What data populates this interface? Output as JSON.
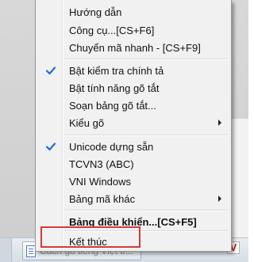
{
  "menu": {
    "items": [
      {
        "label": "Hướng dẫn",
        "checked": false,
        "submenu": false,
        "bold": false
      },
      {
        "label": "Công cụ...[CS+F6]",
        "checked": false,
        "submenu": false,
        "bold": false
      },
      {
        "label": "Chuyển mã nhanh - [CS+F9]",
        "checked": false,
        "submenu": false,
        "bold": false
      },
      {
        "label": "Bật kiểm tra chính tả",
        "checked": true,
        "submenu": false,
        "bold": false
      },
      {
        "label": "Bật tính năng gõ tắt",
        "checked": false,
        "submenu": false,
        "bold": false
      },
      {
        "label": "Soạn bảng gõ tắt...",
        "checked": false,
        "submenu": false,
        "bold": false
      },
      {
        "label": "Kiểu gõ",
        "checked": false,
        "submenu": true,
        "bold": false
      },
      {
        "label": "Unicode dựng sẵn",
        "checked": true,
        "submenu": false,
        "bold": false
      },
      {
        "label": "TCVN3 (ABC)",
        "checked": false,
        "submenu": false,
        "bold": false
      },
      {
        "label": "VNI Windows",
        "checked": false,
        "submenu": false,
        "bold": false
      },
      {
        "label": "Bảng mã khác",
        "checked": false,
        "submenu": true,
        "bold": false
      },
      {
        "label": "Bảng điều khiển...[CS+F5]",
        "checked": false,
        "submenu": false,
        "bold": true
      },
      {
        "label": "Kết thúc",
        "checked": false,
        "submenu": false,
        "bold": false,
        "highlighted": true
      }
    ]
  },
  "taskbar": {
    "window_label": "Cách gõ tiếng Việt tr...",
    "tray_icon_letter": "V"
  },
  "colors": {
    "check": "#1f6fd1",
    "highlight_border": "#d23a3a",
    "tray_v": "#d11a1a"
  }
}
